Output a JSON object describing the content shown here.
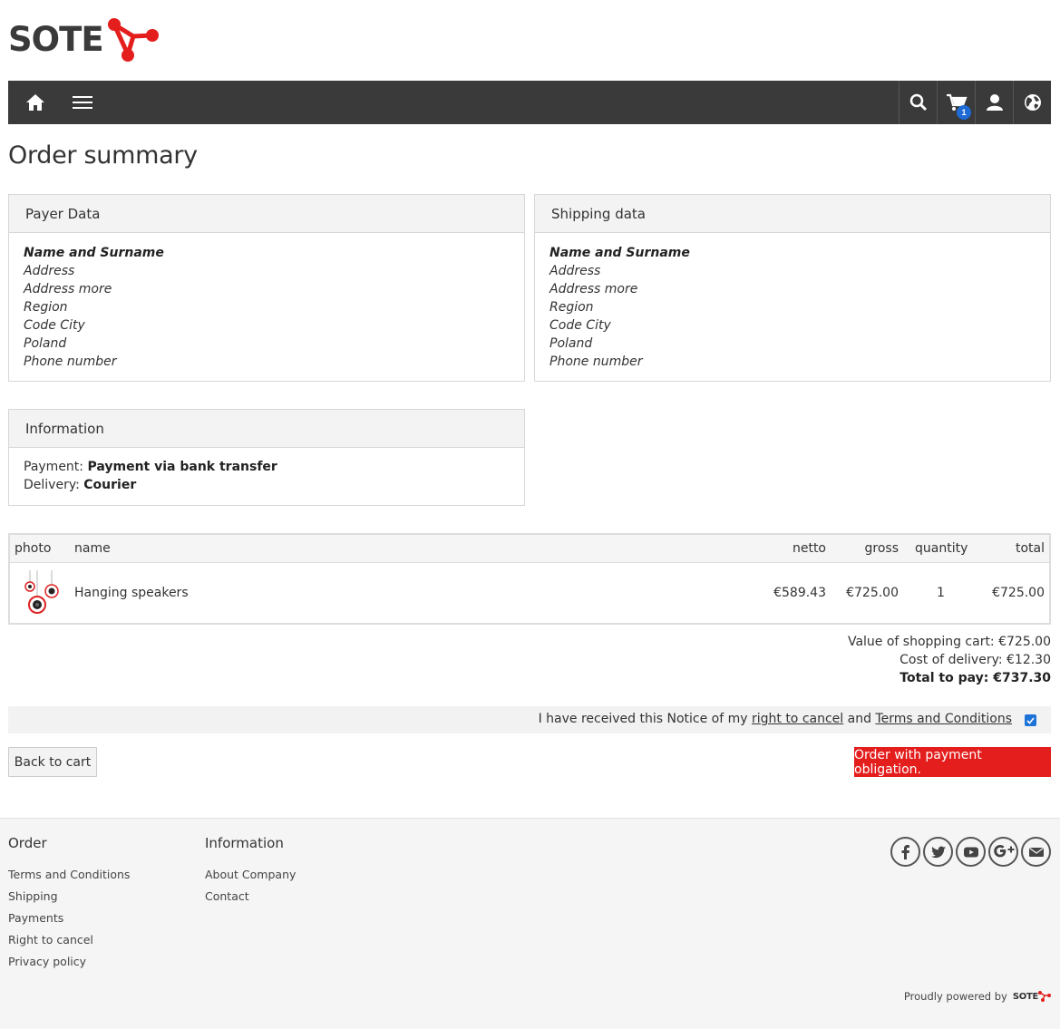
{
  "brand": {
    "name": "SOTE",
    "accent": "#e41d1d"
  },
  "nav": {
    "home_icon": "home-icon",
    "menu_icon": "hamburger-menu-icon",
    "cart_count": "1",
    "right_icons": [
      "search-icon",
      "cart-icon",
      "user-icon",
      "globe-icon"
    ]
  },
  "page": {
    "title": "Order summary"
  },
  "payer": {
    "heading": "Payer Data",
    "name": "Name and Surname",
    "address": "Address",
    "address_more": "Address more",
    "region": "Region",
    "code_city": "Code City",
    "country": "Poland",
    "phone": "Phone number"
  },
  "shipping": {
    "heading": "Shipping data",
    "name": "Name and Surname",
    "address": "Address",
    "address_more": "Address more",
    "region": "Region",
    "code_city": "Code City",
    "country": "Poland",
    "phone": "Phone number"
  },
  "information": {
    "heading": "Information",
    "payment_label": "Payment:",
    "payment_value": "Payment via bank transfer",
    "delivery_label": "Delivery:",
    "delivery_value": "Courier"
  },
  "cart": {
    "columns": {
      "photo": "photo",
      "name": "name",
      "netto": "netto",
      "gross": "gross",
      "quantity": "quantity",
      "total": "total"
    },
    "rows": [
      {
        "name": "Hanging speakers",
        "netto": "€589.43",
        "gross": "€725.00",
        "quantity": "1",
        "total": "€725.00"
      }
    ]
  },
  "totals": {
    "cart_value": "Value of shopping cart: €725.00",
    "delivery_cost": "Cost of delivery: €12.30",
    "total_to_pay": "Total to pay: €737.30"
  },
  "consent": {
    "prefix": "I have received this Notice of my",
    "link1": "right to cancel",
    "middle": "and",
    "link2": "Terms and Conditions",
    "checked": true
  },
  "buttons": {
    "back": "Back to cart",
    "order": "Order with payment obligation."
  },
  "footer": {
    "col1": {
      "heading": "Order",
      "links": [
        "Terms and Conditions",
        "Shipping",
        "Payments",
        "Right to cancel",
        "Privacy policy"
      ]
    },
    "col2": {
      "heading": "Information",
      "links": [
        "About Company",
        "Contact"
      ]
    },
    "social": [
      "facebook-icon",
      "twitter-icon",
      "youtube-icon",
      "google-plus-icon",
      "email-icon"
    ],
    "powered_by": "Proudly powered by",
    "powered_logo": "SOTE"
  }
}
